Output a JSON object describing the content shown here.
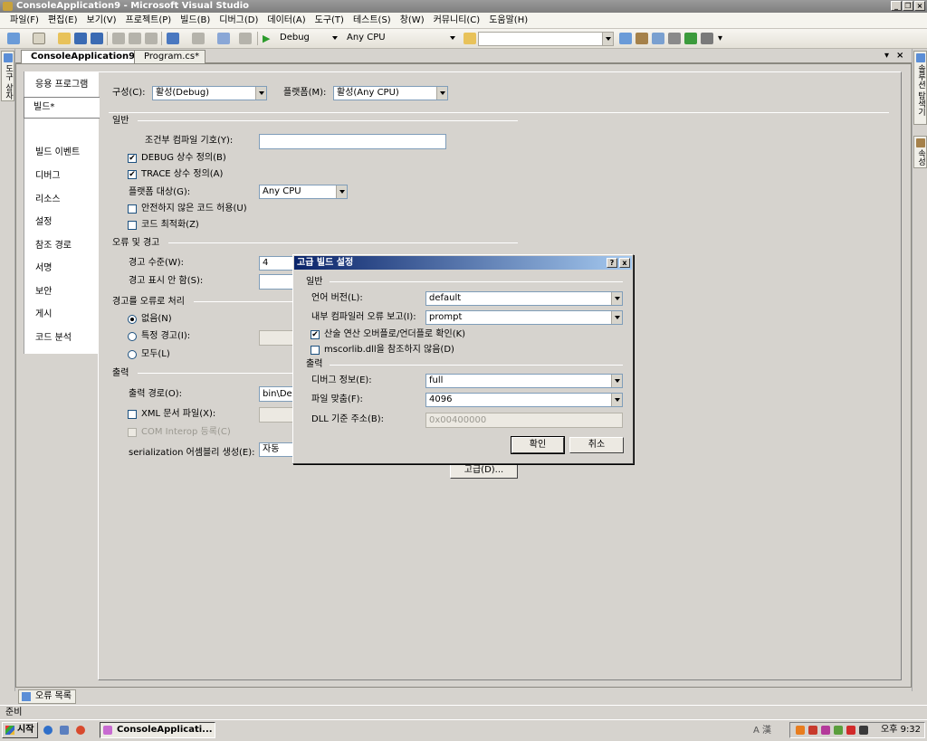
{
  "window": {
    "title": "ConsoleApplication9 - Microsoft Visual Studio"
  },
  "menu": [
    "파일(F)",
    "편집(E)",
    "보기(V)",
    "프로젝트(P)",
    "빌드(B)",
    "디버그(D)",
    "데이터(A)",
    "도구(T)",
    "테스트(S)",
    "창(W)",
    "커뮤니티(C)",
    "도움말(H)"
  ],
  "toolbar": {
    "config": "Debug",
    "platform": "Any CPU",
    "find": ""
  },
  "side_tabs": {
    "left": "도구 상자",
    "right_1": "솔루션 탐색기",
    "right_2": "속성"
  },
  "doc_tabs": [
    "ConsoleApplication9*",
    "Program.cs*"
  ],
  "nav": [
    "응용 프로그램",
    "빌드*",
    "빌드 이벤트",
    "디버그",
    "리소스",
    "설정",
    "참조 경로",
    "서명",
    "보안",
    "게시",
    "코드 분석"
  ],
  "build": {
    "config_label": "구성(C):",
    "config_value": "활성(Debug)",
    "platform_label": "플랫폼(M):",
    "platform_value": "활성(Any CPU)",
    "general_header": "일반",
    "cond_symbols_label": "조건부 컴파일 기호(Y):",
    "cond_symbols_value": "",
    "debug_const_label": "DEBUG 상수 정의(B)",
    "debug_const_checked": true,
    "trace_const_label": "TRACE 상수 정의(A)",
    "trace_const_checked": true,
    "platform_target_label": "플랫폼 대상(G):",
    "platform_target_value": "Any CPU",
    "unsafe_label": "안전하지 않은 코드 허용(U)",
    "unsafe_checked": false,
    "optimize_label": "코드 최적화(Z)",
    "optimize_checked": false,
    "errors_header": "오류 및 경고",
    "warning_level_label": "경고 수준(W):",
    "warning_level_value": "4",
    "suppress_label": "경고 표시 안 함(S):",
    "suppress_value": "",
    "treat_header": "경고를 오류로 처리",
    "treat_none_label": "없음(N)",
    "treat_specific_label": "특정 경고(I):",
    "treat_all_label": "모두(L)",
    "treat_selected": "none",
    "output_header": "출력",
    "output_path_label": "출력 경로(O):",
    "output_path_value": "bin\\De",
    "xml_doc_label": "XML 문서 파일(X):",
    "xml_doc_checked": false,
    "com_interop_label": "COM Interop 등록(C)",
    "com_interop_checked": false,
    "serialization_label": "serialization 어셈블리 생성(E):",
    "serialization_value": "자동",
    "advanced_button": "고급(D)..."
  },
  "dialog": {
    "title": "고급 빌드 설정",
    "help_btn": "?",
    "close_btn": "x",
    "general_header": "일반",
    "lang_version_label": "언어 버전(L):",
    "lang_version_value": "default",
    "compiler_error_label": "내부 컴파일러 오류 보고(I):",
    "compiler_error_value": "prompt",
    "overflow_label": "산술 연산 오버플로/언더플로 확인(K)",
    "overflow_checked": true,
    "mscorlib_label": "mscorlib.dll을 참조하지 않음(D)",
    "mscorlib_checked": false,
    "output_header": "출력",
    "debug_info_label": "디버그 정보(E):",
    "debug_info_value": "full",
    "file_align_label": "파일 맞춤(F):",
    "file_align_value": "4096",
    "dll_base_label": "DLL 기준 주소(B):",
    "dll_base_value": "0x00400000",
    "ok_button": "확인",
    "cancel_button": "취소"
  },
  "bottom": {
    "error_list_tab": "오류 목록",
    "status": "준비"
  },
  "taskbar": {
    "start": "시작",
    "task_item": "ConsoleApplicati...",
    "ime": "A 漢",
    "clock": "오후 9:32"
  },
  "check_mark": "✔"
}
